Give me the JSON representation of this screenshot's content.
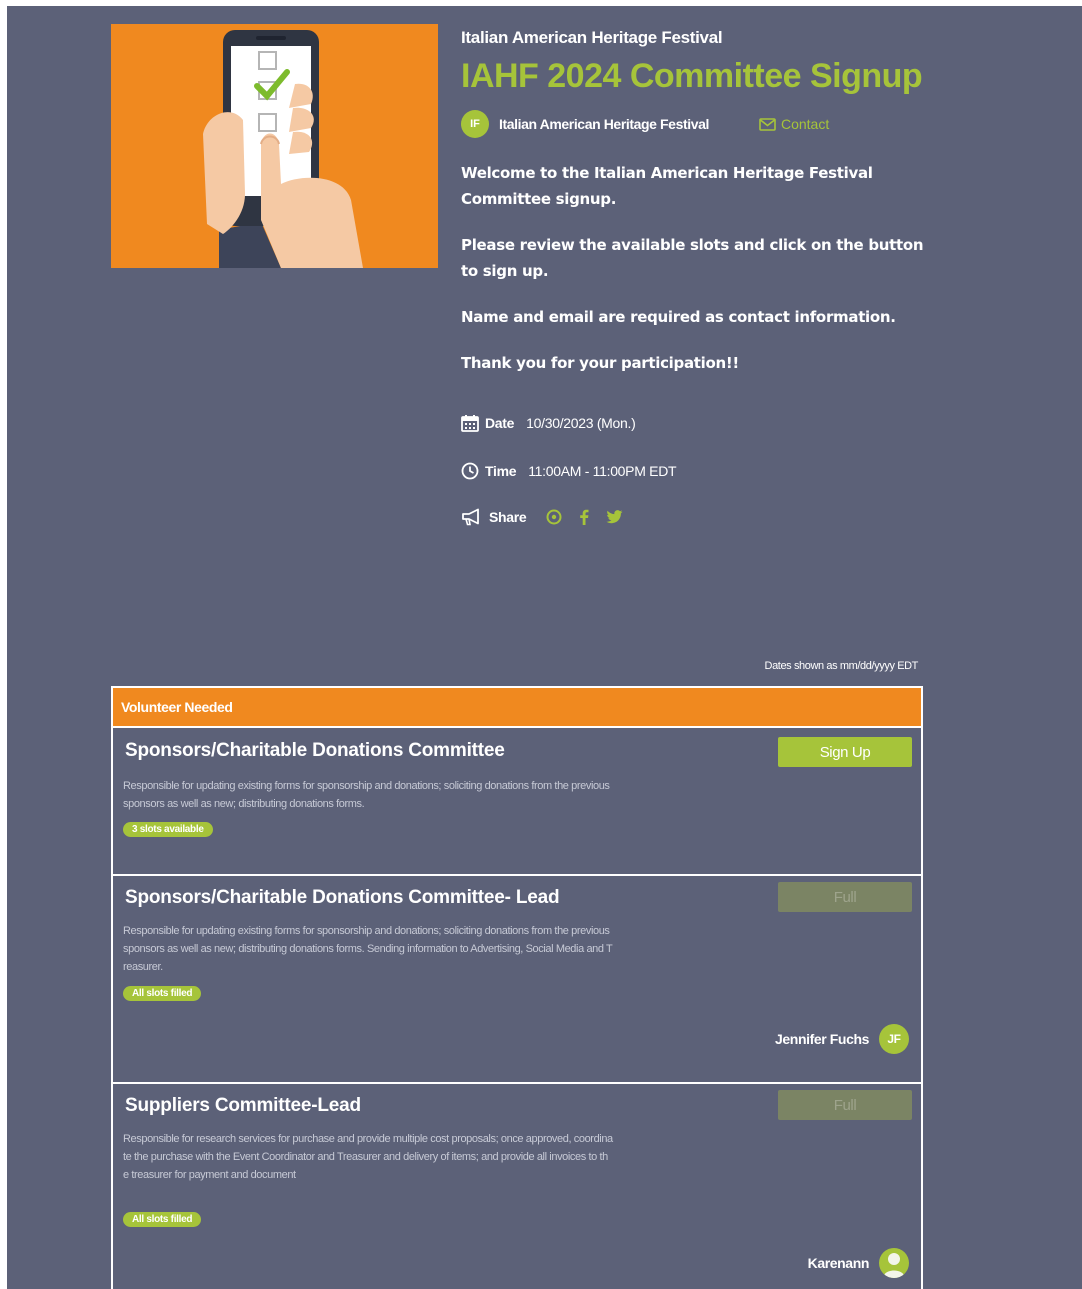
{
  "header": {
    "org_heading": "Italian American Heritage Festival",
    "title": "IAHF 2024 Committee Signup",
    "org_initials": "IF",
    "org_name": "Italian American Heritage Festival",
    "contact_label": "Contact"
  },
  "description": [
    "Welcome to the Italian American Heritage Festival Committee signup.",
    "Please review the available slots and click on the button to sign up.",
    "Name and email are required as contact information.",
    "Thank you for your participation!!"
  ],
  "details": {
    "date_label": "Date",
    "date_value": "10/30/2023 (Mon.)",
    "time_label": "Time",
    "time_value": "11:00AM - 11:00PM EDT",
    "share_label": "Share",
    "share_icons": [
      "pinterest-icon",
      "facebook-icon",
      "twitter-icon"
    ]
  },
  "dates_note": "Dates shown as mm/dd/yyyy EDT",
  "table": {
    "header": "Volunteer Needed",
    "slots": [
      {
        "title": "Sponsors/Charitable Donations Committee",
        "description": "Responsible for updating existing forms for sponsorship and donations; soliciting donations from the previous sponsors as well as new; distributing donations forms.",
        "badge": "3 slots available",
        "button": "Sign Up"
      },
      {
        "title": "Sponsors/Charitable Donations Committee- Lead",
        "description": "Responsible for updating existing forms for sponsorship and donations; soliciting donations from the previous sponsors as well as new; distributing donations forms. Sending information to Advertising, Social Media and Treasurer.",
        "badge": "All slots filled",
        "button": "Full",
        "signer_name": "Jennifer Fuchs",
        "signer_initials": "JF"
      },
      {
        "title": "Suppliers Committee-Lead",
        "description": "Responsible for research services for purchase and provide multiple cost proposals; once approved, coordinate the purchase with the Event Coordinator and Treasurer and delivery of items; and provide all invoices to the treasurer for payment and document",
        "badge": "All slots filled",
        "button": "Full",
        "signer_name": "Karenann"
      }
    ]
  },
  "colors": {
    "background": "#5c6178",
    "accent_green": "#a6c43a",
    "accent_orange": "#f0891f"
  }
}
